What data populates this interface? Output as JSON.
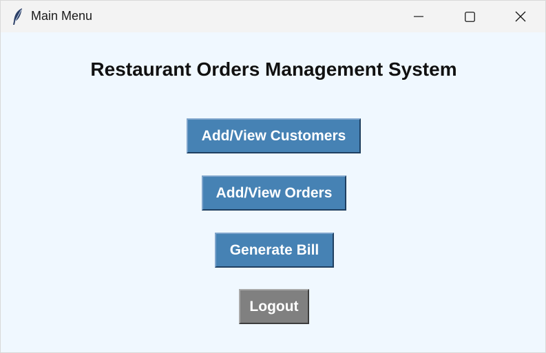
{
  "window": {
    "title": "Main Menu",
    "app_icon": "feather-icon",
    "controls": {
      "minimize_icon": "minimize-icon",
      "maximize_icon": "maximize-icon",
      "close_icon": "close-icon"
    }
  },
  "main": {
    "heading": "Restaurant Orders Management System",
    "buttons": {
      "customers": "Add/View Customers",
      "orders": "Add/View Orders",
      "bill": "Generate Bill",
      "logout": "Logout"
    }
  },
  "colors": {
    "background": "#f0f8ff",
    "primary_button": "#4682b4",
    "logout_button": "#808080",
    "button_text": "#ffffff"
  }
}
